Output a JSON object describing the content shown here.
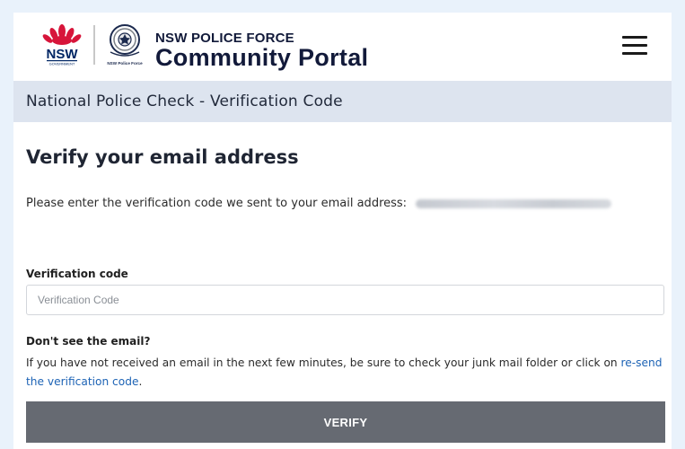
{
  "header": {
    "logo_nsw": {
      "wordmark": "NSW",
      "subtext": "GOVERNMENT"
    },
    "logo_police": {
      "subtext": "NSW Police Force"
    },
    "brand_small": "NSW POLICE FORCE",
    "brand_big": "Community Portal",
    "menu_icon": "hamburger-menu-icon"
  },
  "subheader": {
    "title": "National Police Check - Verification Code"
  },
  "main": {
    "title": "Verify your email address",
    "instruction": "Please enter the verification code we sent to your email address:",
    "code_field": {
      "label": "Verification code",
      "placeholder": "Verification Code",
      "value": ""
    },
    "help": {
      "title": "Don't see the email?",
      "text_before": "If you have not received an email in the next few minutes, be sure to check your junk mail folder or click on ",
      "link_text": "re-send the verification code",
      "text_after": "."
    },
    "verify_label": "VERIFY"
  },
  "colors": {
    "page_background": "#e9f2fb",
    "brand_navy": "#121a3a",
    "subheader_band": "#dde4ef",
    "link": "#1d63b5",
    "button": "#666a72",
    "nsw_waratah_red": "#d7153a",
    "nsw_blue": "#002664"
  }
}
